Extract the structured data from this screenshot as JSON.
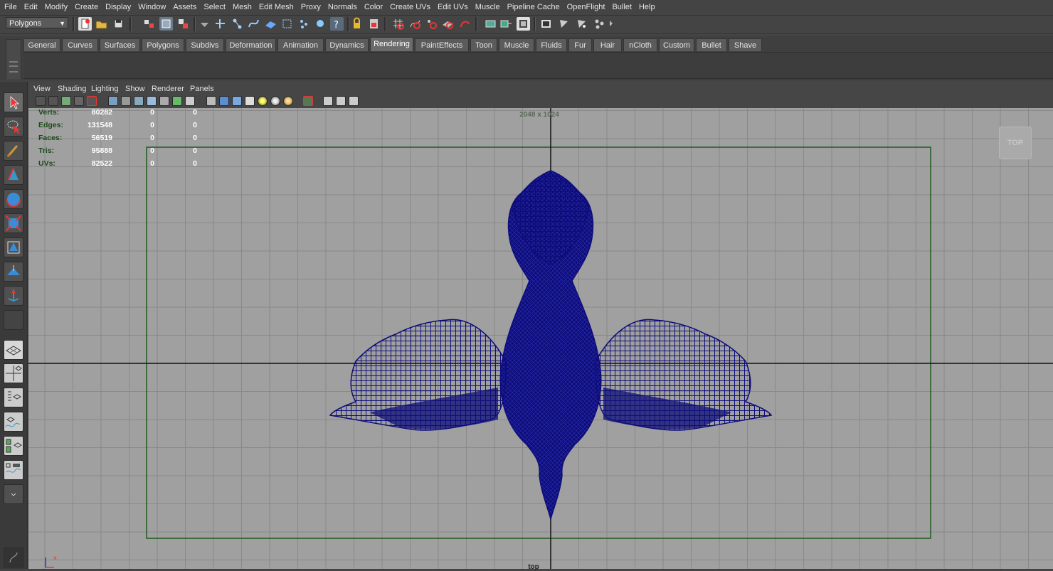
{
  "menubar": {
    "items": [
      "File",
      "Edit",
      "Modify",
      "Create",
      "Display",
      "Window",
      "Assets",
      "Select",
      "Mesh",
      "Edit Mesh",
      "Proxy",
      "Normals",
      "Color",
      "Create UVs",
      "Edit UVs",
      "Muscle",
      "Pipeline Cache",
      "OpenFlight",
      "Bullet",
      "Help"
    ]
  },
  "status_line": {
    "mode": "Polygons"
  },
  "shelf": {
    "tabs": [
      "General",
      "Curves",
      "Surfaces",
      "Polygons",
      "Subdivs",
      "Deformation",
      "Animation",
      "Dynamics",
      "Rendering",
      "PaintEffects",
      "Toon",
      "Muscle",
      "Fluids",
      "Fur",
      "Hair",
      "nCloth",
      "Custom",
      "Bullet",
      "Shave"
    ],
    "active_tab": "Rendering"
  },
  "panel": {
    "menu": [
      "View",
      "Shading",
      "Lighting",
      "Show",
      "Renderer",
      "Panels"
    ]
  },
  "hud": {
    "rows": [
      {
        "label": "Verts:",
        "total": "80282",
        "selected": "0",
        "uv_selected": "0"
      },
      {
        "label": "Edges:",
        "total": "131548",
        "selected": "0",
        "uv_selected": "0"
      },
      {
        "label": "Faces:",
        "total": "56519",
        "selected": "0",
        "uv_selected": "0"
      },
      {
        "label": "Tris:",
        "total": "95888",
        "selected": "0",
        "uv_selected": "0"
      },
      {
        "label": "UVs:",
        "total": "82522",
        "selected": "0",
        "uv_selected": "0"
      }
    ]
  },
  "viewport": {
    "resolution_gate": "2048 x 1024",
    "view_cube": "TOP",
    "camera": "top",
    "wire_color": "#0d0d7a",
    "gate_color": "#1e5a1e",
    "background": "#a0a0a0"
  },
  "icons": {
    "toolbox": [
      "select-arrow-icon",
      "lasso-select-icon",
      "paint-select-icon",
      "move-tool-icon",
      "rotate-tool-icon",
      "scale-tool-icon",
      "universal-manipulator-icon",
      "soft-mod-icon",
      "show-manipulator-icon",
      "last-tool-icon",
      "single-perspective-layout-icon",
      "four-view-layout-icon",
      "outliner-perspective-layout-icon",
      "graph-editor-layout-icon",
      "hypershade-layout-icon",
      "outliner-graph-layout-icon",
      "more-layouts-icon"
    ]
  }
}
